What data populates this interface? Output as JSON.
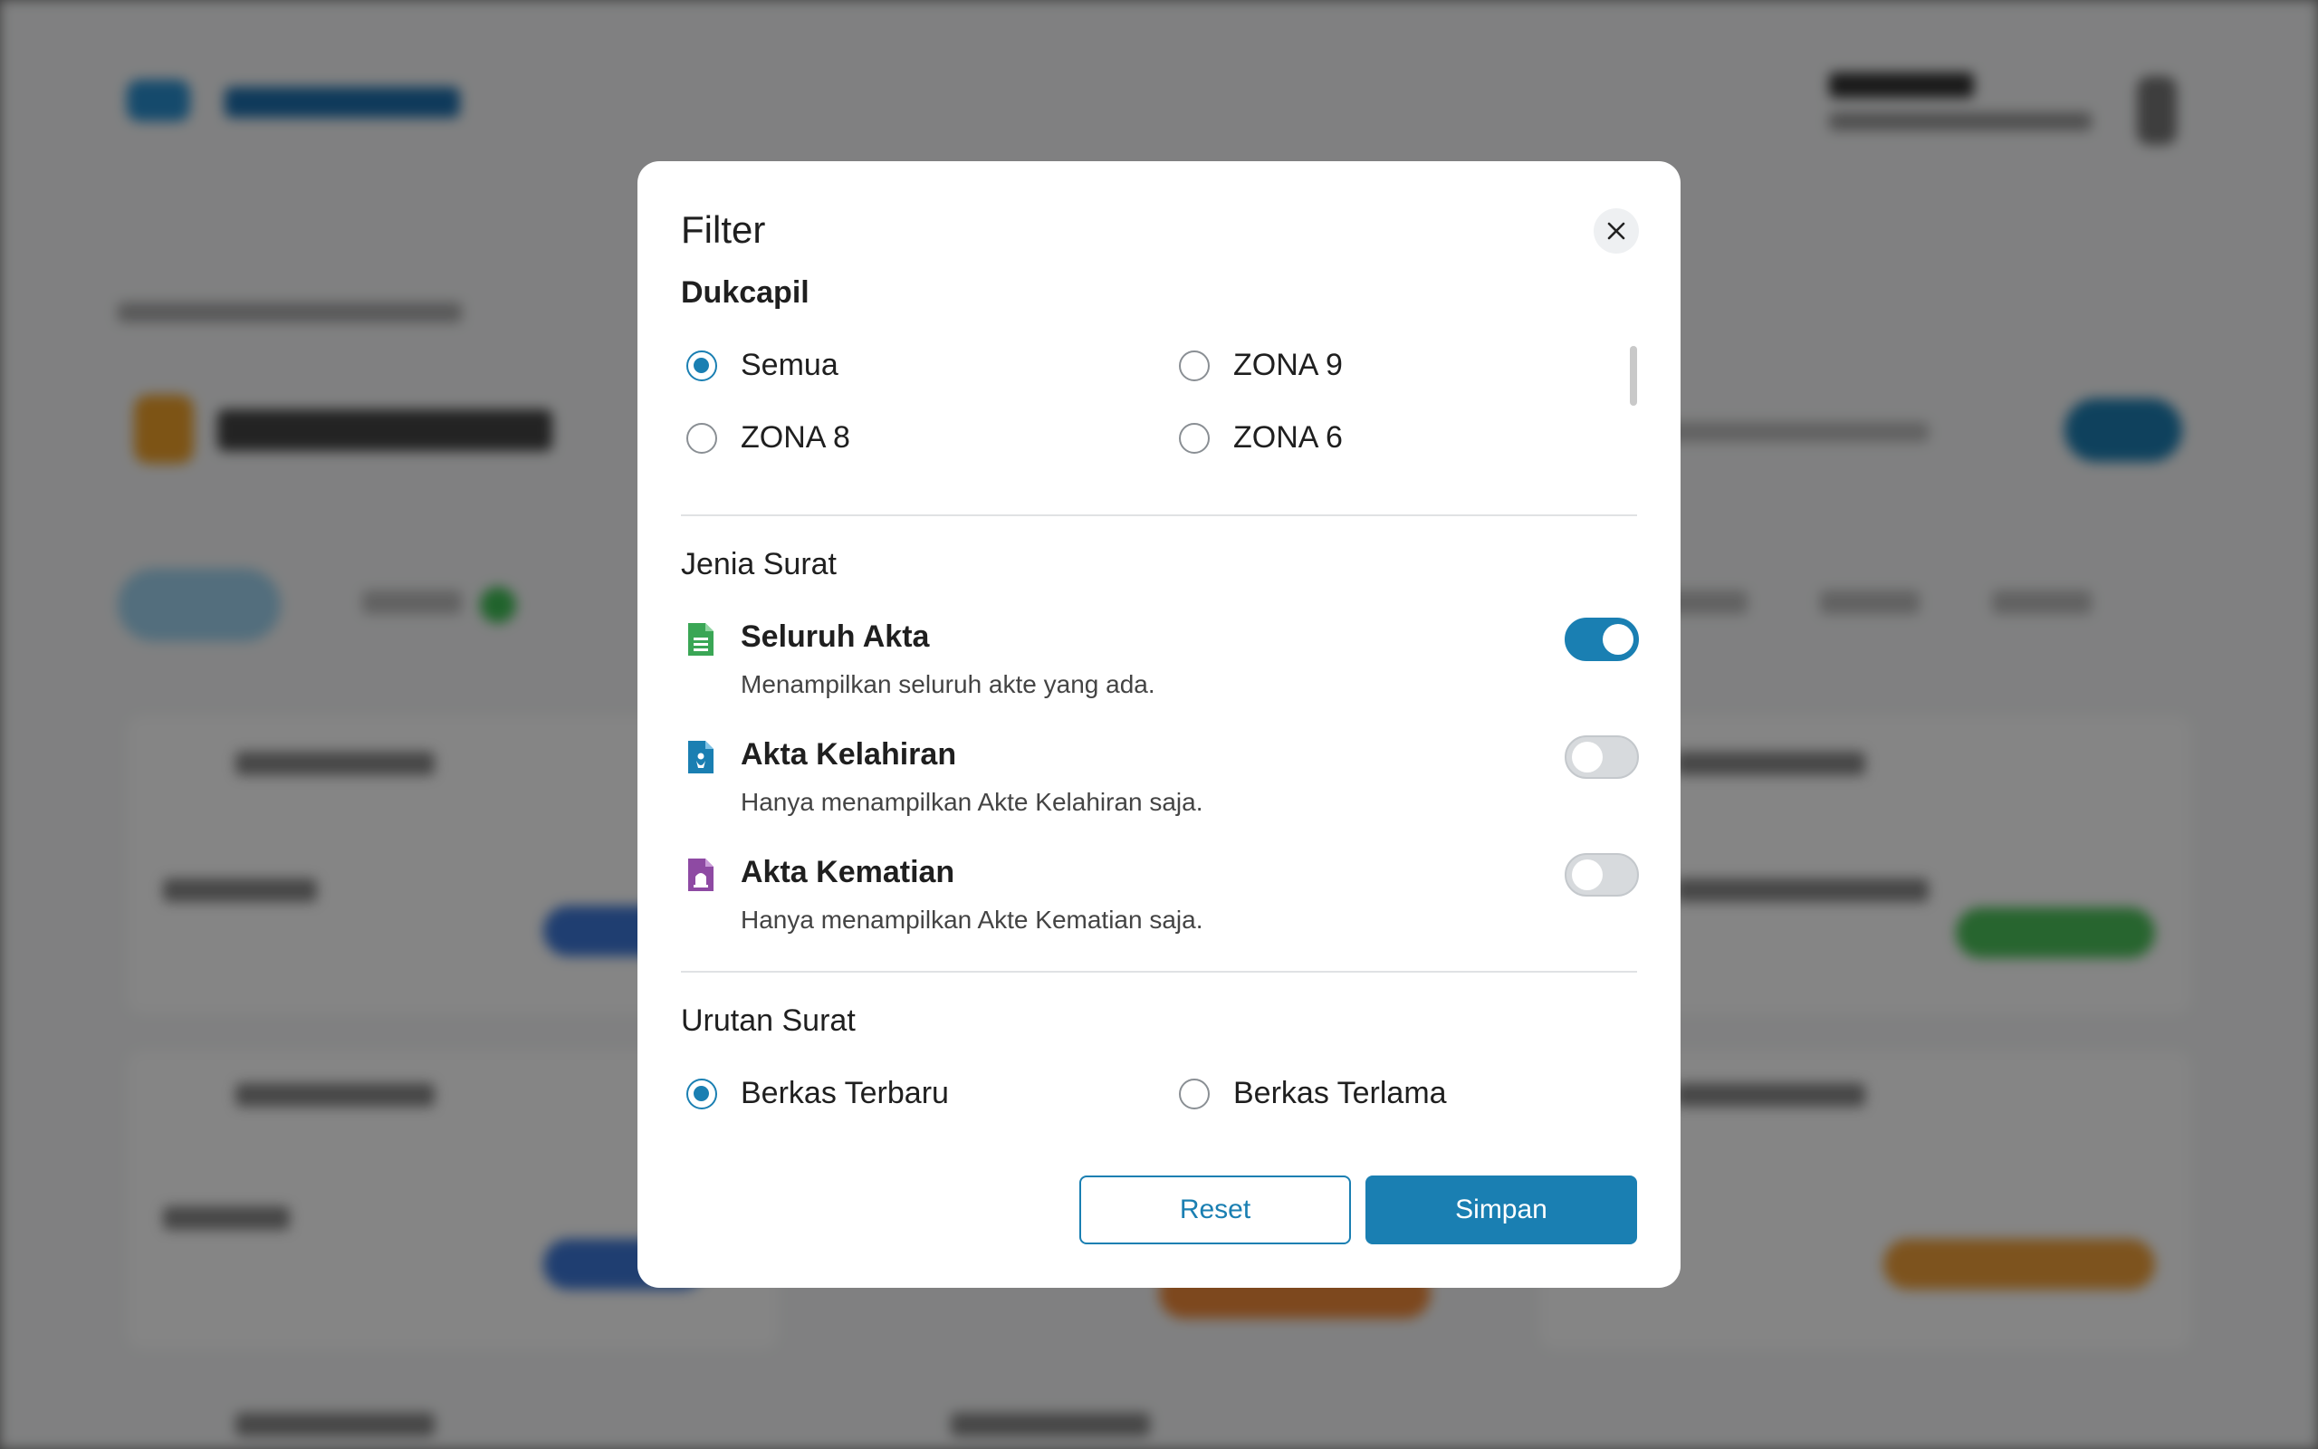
{
  "modal": {
    "title": "Filter",
    "close_icon": "close-icon"
  },
  "dukcapil": {
    "title": "Dukcapil",
    "options": [
      {
        "label": "Semua",
        "selected": true
      },
      {
        "label": "ZONA 9",
        "selected": false
      },
      {
        "label": "ZONA 8",
        "selected": false
      },
      {
        "label": "ZONA 6",
        "selected": false
      }
    ]
  },
  "jenis_surat": {
    "title": "Jenia Surat",
    "items": [
      {
        "label": "Seluruh Akta",
        "description": "Menampilkan seluruh akte yang ada.",
        "enabled": true,
        "icon": "document-icon",
        "icon_color": "#3aa655"
      },
      {
        "label": "Akta Kelahiran",
        "description": "Hanya menampilkan Akte Kelahiran saja.",
        "enabled": false,
        "icon": "baby-document-icon",
        "icon_color": "#1a7fb2"
      },
      {
        "label": "Akta Kematian",
        "description": "Hanya menampilkan Akte Kematian saja.",
        "enabled": false,
        "icon": "tombstone-document-icon",
        "icon_color": "#8e4aa3"
      }
    ]
  },
  "urutan_surat": {
    "title": "Urutan Surat",
    "options": [
      {
        "label": "Berkas Terbaru",
        "selected": true
      },
      {
        "label": "Berkas Terlama",
        "selected": false
      }
    ]
  },
  "actions": {
    "reset_label": "Reset",
    "save_label": "Simpan"
  },
  "colors": {
    "primary": "#1a7fb2"
  }
}
